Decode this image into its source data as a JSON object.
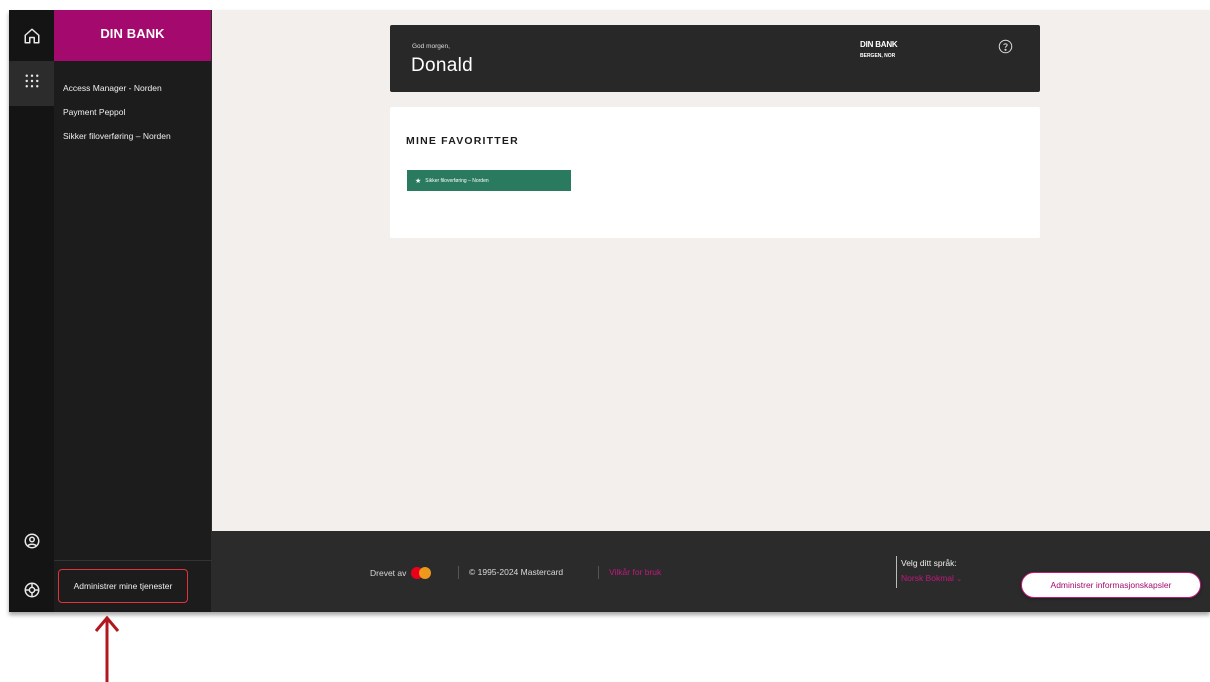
{
  "sidebar": {
    "bank_name": "DIN BANK",
    "services": [
      "Access Manager - Norden",
      "Payment Peppol",
      "Sikker filoverføring – Norden"
    ],
    "manage_label": "Administrer mine tjenester"
  },
  "rail": {
    "icons": [
      "home-icon",
      "apps-grid-icon",
      "user-profile-icon",
      "support-icon"
    ]
  },
  "greeting": {
    "small": "God morgen,",
    "name": "Donald",
    "bank": "DIN BANK",
    "location": "BERGEN, NOR"
  },
  "favorites": {
    "title": "MINE FAVORITTER",
    "items": [
      "Sikker filoverføring – Norden"
    ]
  },
  "footer": {
    "powered_by": "Drevet av",
    "copyright": "© 1995-2024 Mastercard",
    "terms": "Vilkår for bruk",
    "language_label": "Velg ditt språk:",
    "language_value": "Norsk Bokmal",
    "cookie_button": "Administrer informasjonskapsler"
  },
  "colors": {
    "brand": "#a4096d",
    "favorite_chip": "#2a7a5f",
    "link": "#c2187c",
    "annotation": "#b0181e"
  }
}
